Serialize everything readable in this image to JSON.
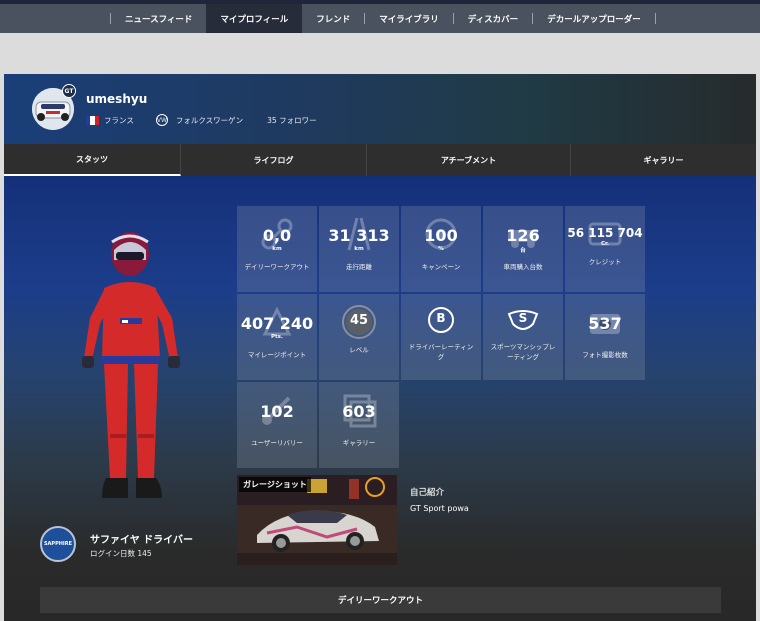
{
  "nav": {
    "items": [
      {
        "label": "ニュースフィード",
        "active": false
      },
      {
        "label": "マイプロフィール",
        "active": true
      },
      {
        "label": "フレンド",
        "active": false
      },
      {
        "label": "マイライブラリ",
        "active": false
      },
      {
        "label": "ディスカバー",
        "active": false
      },
      {
        "label": "デカールアップローダー",
        "active": false
      }
    ]
  },
  "profile": {
    "username": "umeshyu",
    "country": "フランス",
    "manufacturer": "フォルクスワーゲン",
    "followers": "35 フォロワー",
    "avatar_badge": "GT"
  },
  "tabs": [
    {
      "label": "スタッツ",
      "active": true
    },
    {
      "label": "ライフログ",
      "active": false
    },
    {
      "label": "アチーブメント",
      "active": false
    },
    {
      "label": "ギャラリー",
      "active": false
    }
  ],
  "stats": [
    {
      "value": "0,0",
      "unit": "km",
      "label": "デイリーワークアウト",
      "icon": "workout-icon"
    },
    {
      "value": "31 313",
      "unit": "km",
      "label": "走行距離",
      "icon": "road-icon"
    },
    {
      "value": "100",
      "unit": "%",
      "label": "キャンペーン",
      "icon": "campaign-icon"
    },
    {
      "value": "126",
      "unit": "台",
      "label": "車両購入台数",
      "icon": "car-icon"
    },
    {
      "value": "56 115 704",
      "unit": "Cr.",
      "label": "クレジット",
      "icon": "credit-icon"
    },
    {
      "value": "407 240",
      "unit": "Pts.",
      "label": "マイレージポイント",
      "icon": "mileage-icon"
    },
    {
      "value": "45",
      "unit": "",
      "label": "レベル",
      "icon": "level-icon"
    },
    {
      "value": "B",
      "unit": "",
      "label": "ドライバーレーティング",
      "icon": "driver-rating-icon"
    },
    {
      "value": "S",
      "unit": "",
      "label": "スポーツマンシップレーティング",
      "icon": "sportsmanship-icon"
    },
    {
      "value": "537",
      "unit": "",
      "label": "フォト撮影枚数",
      "icon": "camera-icon"
    },
    {
      "value": "102",
      "unit": "",
      "label": "ユーザーリバリー",
      "icon": "livery-icon"
    },
    {
      "value": "603",
      "unit": "",
      "label": "ギャラリー",
      "icon": "gallery-icon"
    }
  ],
  "driver": {
    "rank_title": "サファイヤ ドライバー",
    "login_days": "ログイン日数 145",
    "seal_text": "SAPPHIRE"
  },
  "garage": {
    "label": "ガレージショット"
  },
  "intro": {
    "title": "自己紹介",
    "text": "GT Sport powa"
  },
  "daily_workout": {
    "label": "デイリーワークアウト"
  },
  "colors": {
    "topbar": "#4a5260",
    "active_nav": "#262c3a",
    "accent_blue": "#1a3e78"
  }
}
